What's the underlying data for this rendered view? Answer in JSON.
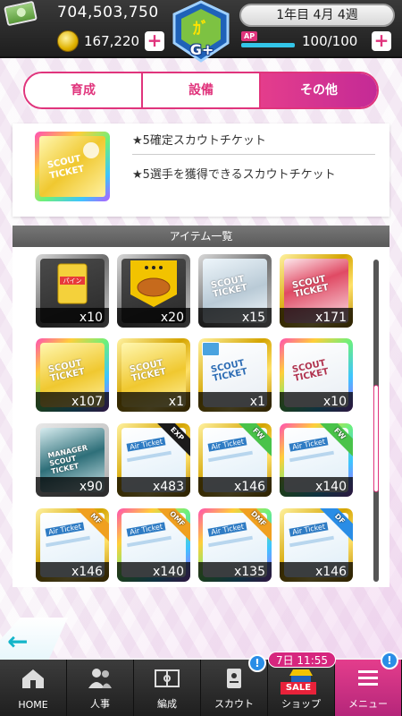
{
  "header": {
    "money": "704,503,750",
    "coins": "167,220",
    "date": "1年目 4月 4週",
    "ap_label": "AP",
    "ap_value": "100/100",
    "ap_fraction": 1.0,
    "rank": "G+"
  },
  "tabs": [
    {
      "label": "育成",
      "active": false
    },
    {
      "label": "設備",
      "active": false
    },
    {
      "label": "その他",
      "active": true
    }
  ],
  "detail": {
    "line1": "★5確定スカウトチケット",
    "line2": "★5選手を獲得できるスカウトチケット"
  },
  "list": {
    "title": "アイテム一覧",
    "items": [
      {
        "count": "x10"
      },
      {
        "count": "x20"
      },
      {
        "count": "x15"
      },
      {
        "count": "x171"
      },
      {
        "count": "x107"
      },
      {
        "count": "x1"
      },
      {
        "count": "x1"
      },
      {
        "count": "x10"
      },
      {
        "count": "x90"
      },
      {
        "count": "x483",
        "tag": "EXP"
      },
      {
        "count": "x146",
        "tag": "FW"
      },
      {
        "count": "x140",
        "tag": "FW"
      },
      {
        "count": "x146",
        "tag": "MF"
      },
      {
        "count": "x140",
        "tag": "OMF"
      },
      {
        "count": "x135",
        "tag": "DMF"
      },
      {
        "count": "x146",
        "tag": "DF"
      }
    ],
    "ticket_labels": {
      "scout": "SCOUT\nTICKET",
      "manager": "MANAGER\nSCOUT\nTICKET",
      "air": "Air Ticket"
    }
  },
  "nav": {
    "items": [
      {
        "label": "HOME"
      },
      {
        "label": "人事"
      },
      {
        "label": "編成"
      },
      {
        "label": "スカウト"
      },
      {
        "label": "ショップ"
      },
      {
        "label": "メニュー"
      }
    ],
    "sale_timer": "7日 11:55",
    "sale_badge": "SALE",
    "notif": "!"
  },
  "colors": {
    "accent": "#e0347c",
    "teal": "#14b5c9"
  }
}
